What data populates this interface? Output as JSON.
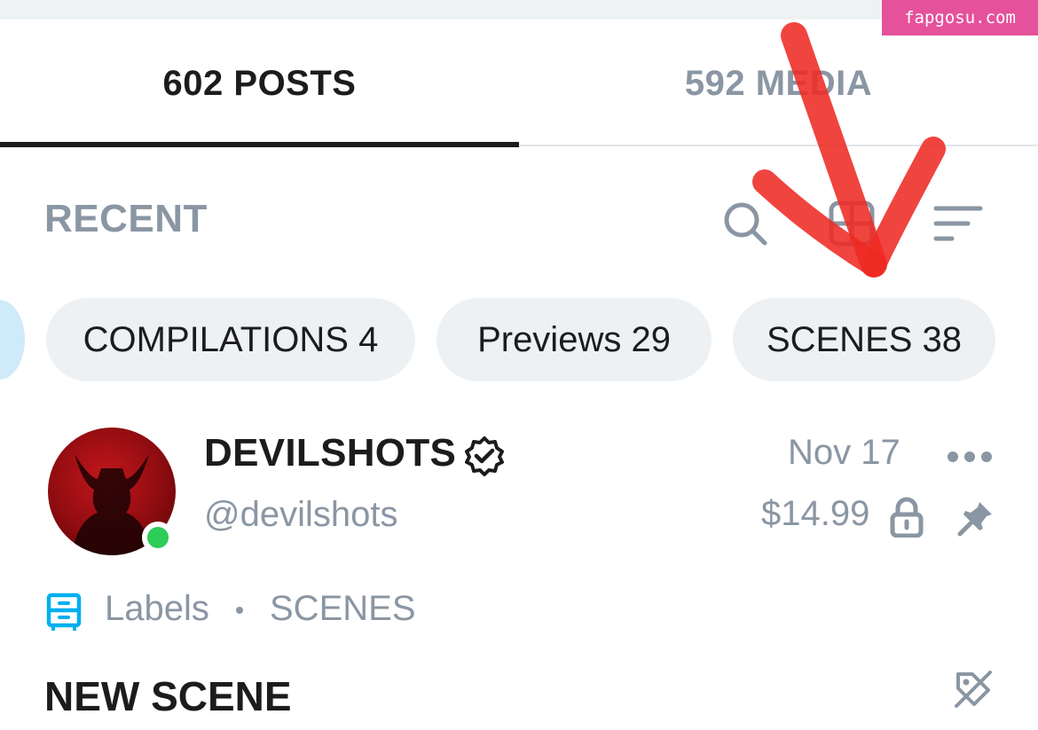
{
  "watermark": "fapgosu.com",
  "tabs": [
    {
      "label": "602 POSTS",
      "active": true
    },
    {
      "label": "592 MEDIA",
      "active": false
    }
  ],
  "section": {
    "title": "RECENT"
  },
  "toolbar": {
    "icons": [
      "search-icon",
      "grid-icon",
      "sort-icon"
    ]
  },
  "chips": [
    {
      "label": "COMPILATIONS 4"
    },
    {
      "label": "Previews 29"
    },
    {
      "label": "SCENES 38"
    }
  ],
  "post": {
    "display_name": "DEVILSHOTS",
    "username": "@devilshots",
    "date": "Nov 17",
    "price": "$14.99",
    "labels_text": "Labels",
    "labels_value": "SCENES",
    "title": "NEW SCENE"
  },
  "colors": {
    "accent_blue": "#00aff0",
    "muted_text": "#8a96a3",
    "online": "#2ecc59",
    "watermark_bg": "#e5519b",
    "annotation_red": "#ee2a24"
  }
}
